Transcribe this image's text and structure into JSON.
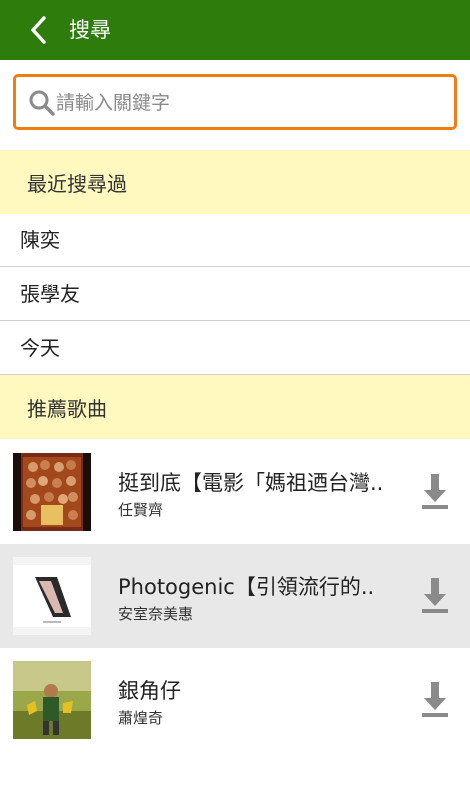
{
  "header": {
    "title": "搜尋",
    "back_icon": "chevron-left-icon",
    "bg_color": "#2e7d0c"
  },
  "search": {
    "placeholder": "請輸入關鍵字",
    "value": "",
    "icon": "search-icon",
    "border_color": "#f07d14"
  },
  "recent": {
    "header": "最近搜尋過",
    "items": [
      "陳奕",
      "張學友",
      "今天"
    ]
  },
  "recommend": {
    "header": "推薦歌曲",
    "songs": [
      {
        "title": "挺到底【電影「媽祖迺台灣..",
        "artist": "任賢齊",
        "download_icon": "download-icon"
      },
      {
        "title": "Photogenic【引領流行的..",
        "artist": "安室奈美惠",
        "download_icon": "download-icon",
        "highlighted": true
      },
      {
        "title": "銀角仔",
        "artist": "蕭煌奇",
        "download_icon": "download-icon"
      }
    ]
  },
  "colors": {
    "section_header_bg": "#fff9c0",
    "selected_row_bg": "#e8e8e8"
  }
}
